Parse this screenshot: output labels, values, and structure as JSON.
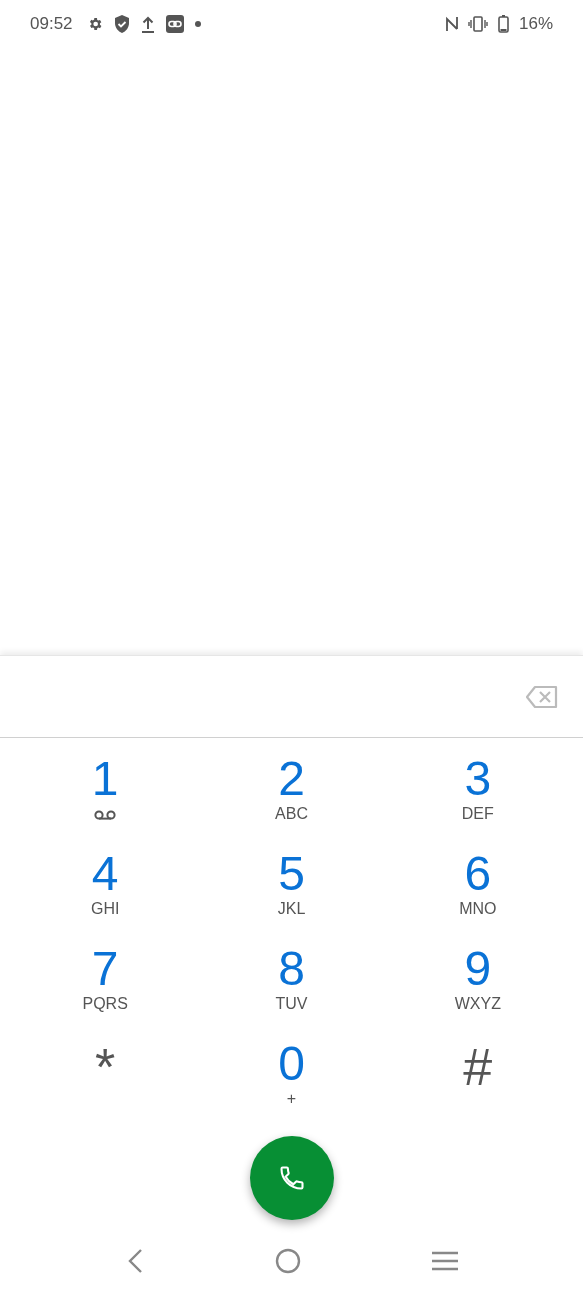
{
  "status_bar": {
    "time": "09:52",
    "battery": "16%"
  },
  "dialpad": {
    "keys": [
      {
        "kind": "voicemail",
        "digit": "1"
      },
      {
        "kind": "digit",
        "digit": "2",
        "letters": "ABC"
      },
      {
        "kind": "digit",
        "digit": "3",
        "letters": "DEF"
      },
      {
        "kind": "digit",
        "digit": "4",
        "letters": "GHI"
      },
      {
        "kind": "digit",
        "digit": "5",
        "letters": "JKL"
      },
      {
        "kind": "digit",
        "digit": "6",
        "letters": "MNO"
      },
      {
        "kind": "digit",
        "digit": "7",
        "letters": "PQRS"
      },
      {
        "kind": "digit",
        "digit": "8",
        "letters": "TUV"
      },
      {
        "kind": "digit",
        "digit": "9",
        "letters": "WXYZ"
      },
      {
        "kind": "symbol",
        "digit": "*"
      },
      {
        "kind": "digit",
        "digit": "0",
        "letters": "+"
      },
      {
        "kind": "symbol",
        "digit": "#"
      }
    ]
  }
}
